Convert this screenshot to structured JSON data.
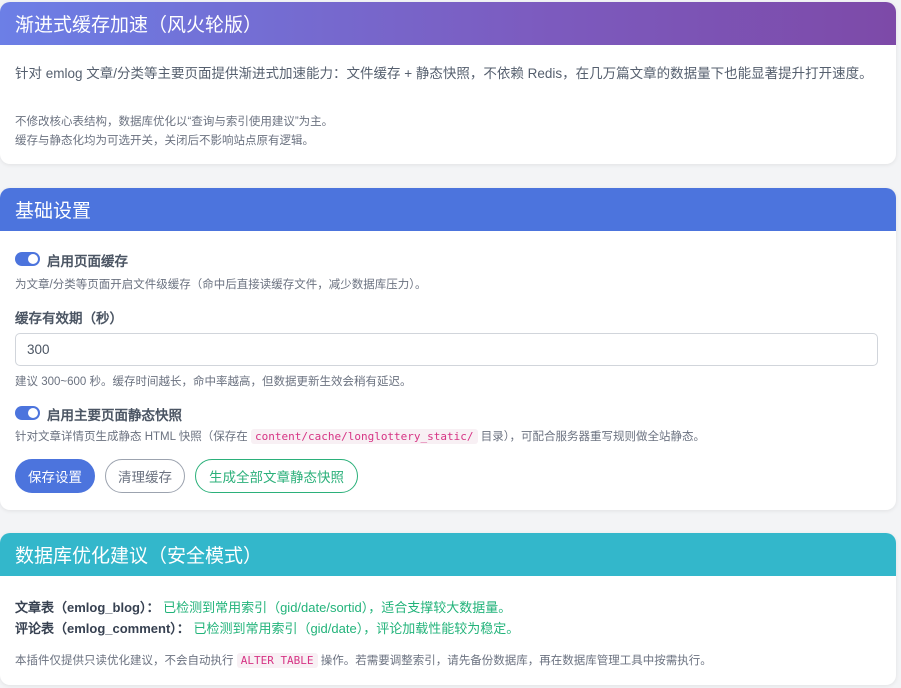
{
  "card1": {
    "title": "渐进式缓存加速（风火轮版）",
    "intro": "针对 emlog 文章/分类等主要页面提供渐进式加速能力：文件缓存 + 静态快照，不依赖 Redis，在几万篇文章的数据量下也能显著提升打开速度。",
    "note1": "不修改核心表结构，数据库优化以“查询与索引使用建议”为主。",
    "note2": "缓存与静态化均为可选开关，关闭后不影响站点原有逻辑。"
  },
  "card2": {
    "title": "基础设置",
    "toggle1_label": "启用页面缓存",
    "toggle1_help": "为文章/分类等页面开启文件级缓存（命中后直接读缓存文件，减少数据库压力）。",
    "ttl_label": "缓存有效期（秒）",
    "ttl_value": "300",
    "ttl_help": "建议 300~600 秒。缓存时间越长，命中率越高，但数据更新生效会稍有延迟。",
    "toggle2_label": "启用主要页面静态快照",
    "toggle2_help_pre": "针对文章详情页生成静态 HTML 快照（保存在",
    "toggle2_help_code": "content/cache/longlottery_static/",
    "toggle2_help_post": "目录），可配合服务器重写规则做全站静态。",
    "save_label": "保存设置",
    "clear_label": "清理缓存",
    "generate_label": "生成全部文章静态快照",
    "toggle1_on": true,
    "toggle2_on": true
  },
  "card3": {
    "title": "数据库优化建议（安全模式）",
    "row1_name": "文章表（emlog_blog）：",
    "row1_status": "已检测到常用索引（gid/date/sortid），适合支撑较大数据量。",
    "row2_name": "评论表（emlog_comment）：",
    "row2_status": "已检测到常用索引（gid/date），评论加载性能较为稳定。",
    "footer_pre": "本插件仅提供只读优化建议，不会自动执行",
    "footer_code": "ALTER TABLE",
    "footer_post": "操作。若需要调整索引，请先备份数据库，再在数据库管理工具中按需执行。"
  },
  "colors": {
    "primary": "#4c74dd",
    "success": "#22b37a",
    "info": "#33b7cb",
    "header_gradient_start": "#6c7fe6",
    "header_gradient_end": "#7d4aa8"
  }
}
